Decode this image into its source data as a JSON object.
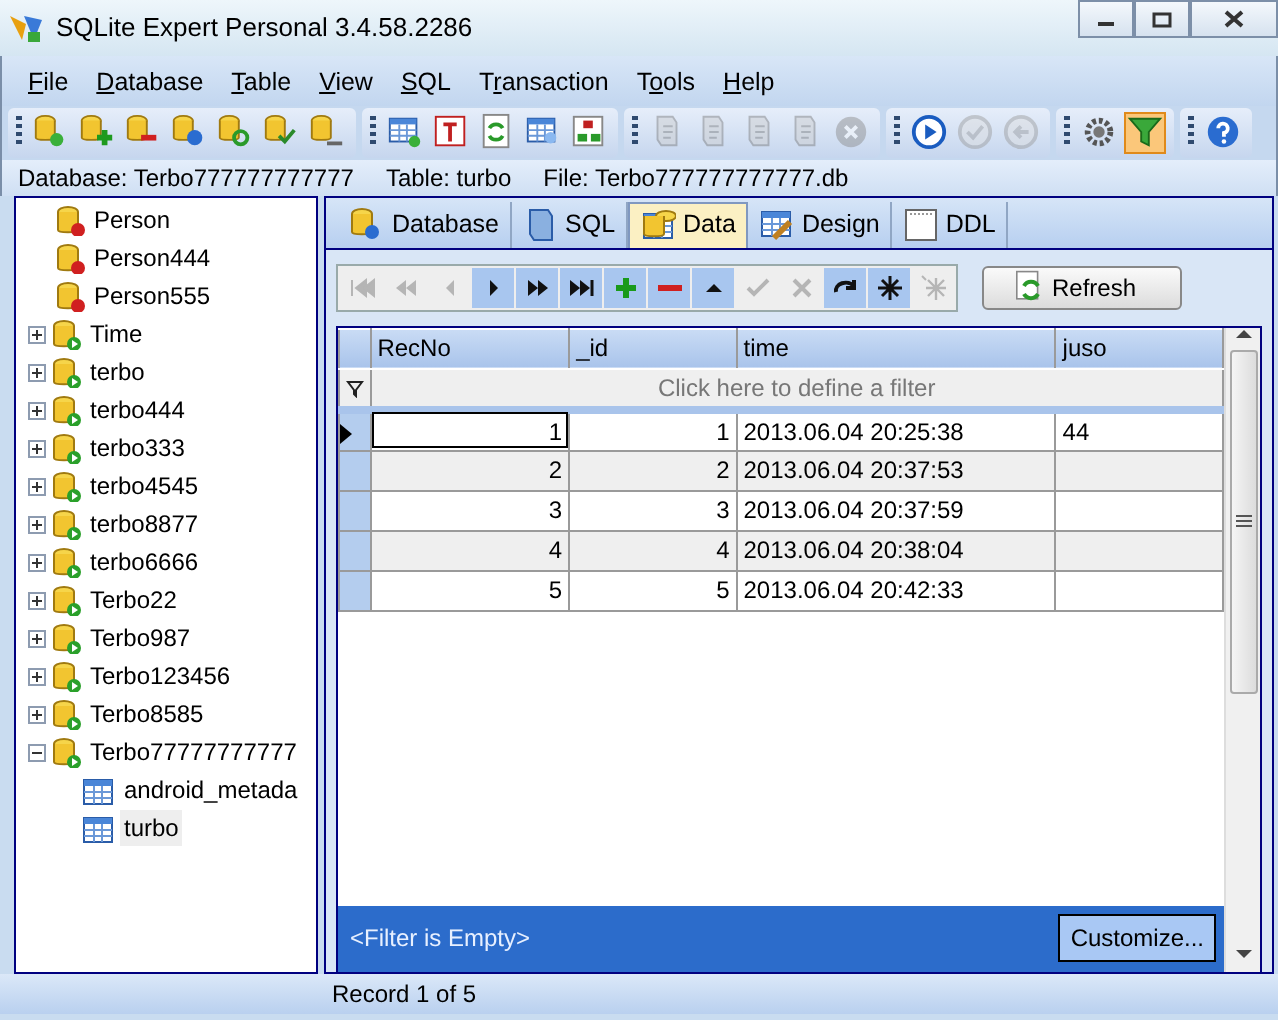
{
  "window": {
    "title": "SQLite Expert Personal 3.4.58.2286"
  },
  "menu": [
    {
      "key": "F",
      "after": "ile"
    },
    {
      "key": "D",
      "after": "atabase"
    },
    {
      "key": "T",
      "after": "able"
    },
    {
      "key": "V",
      "after": "iew"
    },
    {
      "key": "S",
      "after": "QL"
    },
    {
      "before": "T",
      "key": "r",
      "after": "ansaction"
    },
    {
      "before": "T",
      "key": "o",
      "after": "ols"
    },
    {
      "key": "H",
      "after": "elp"
    }
  ],
  "toolbar": [
    [
      {
        "kind": "db-new",
        "disabled": false,
        "on": false
      },
      {
        "kind": "db-add",
        "disabled": false,
        "on": false
      },
      {
        "kind": "db-remove",
        "disabled": false,
        "on": false
      },
      {
        "kind": "db-settings",
        "disabled": false,
        "on": false
      },
      {
        "kind": "db-attach",
        "disabled": false,
        "on": false
      },
      {
        "kind": "db-check",
        "disabled": false,
        "on": false
      },
      {
        "kind": "db-export",
        "disabled": false,
        "on": false
      }
    ],
    [
      {
        "kind": "table-new",
        "disabled": false,
        "on": false
      },
      {
        "kind": "table-text",
        "disabled": false,
        "on": false
      },
      {
        "kind": "refresh",
        "disabled": false,
        "on": false
      },
      {
        "kind": "table-edit",
        "disabled": false,
        "on": false
      },
      {
        "kind": "tree",
        "disabled": false,
        "on": false
      }
    ],
    [
      {
        "kind": "script",
        "disabled": true,
        "on": false
      },
      {
        "kind": "script",
        "disabled": true,
        "on": false
      },
      {
        "kind": "script",
        "disabled": true,
        "on": false
      },
      {
        "kind": "script",
        "disabled": true,
        "on": false
      },
      {
        "kind": "stop",
        "disabled": true,
        "on": false
      }
    ],
    [
      {
        "kind": "play",
        "disabled": false,
        "on": false
      },
      {
        "kind": "check",
        "disabled": true,
        "on": false
      },
      {
        "kind": "back",
        "disabled": true,
        "on": false
      }
    ],
    [
      {
        "kind": "gear",
        "disabled": false,
        "on": false
      },
      {
        "kind": "funnel",
        "disabled": false,
        "on": true
      }
    ],
    [
      {
        "kind": "help",
        "disabled": false,
        "on": false
      }
    ]
  ],
  "info_bar": {
    "database": "Database: Terbo777777777777",
    "table": "Table: turbo",
    "file": "File: Terbo777777777777.db"
  },
  "tree": [
    {
      "label": "Person",
      "kind": "view"
    },
    {
      "label": "Person444",
      "kind": "view"
    },
    {
      "label": "Person555",
      "kind": "view"
    },
    {
      "label": "Time",
      "kind": "database",
      "expanded": false
    },
    {
      "label": "terbo",
      "kind": "database",
      "expanded": false
    },
    {
      "label": "terbo444",
      "kind": "database",
      "expanded": false
    },
    {
      "label": "terbo333",
      "kind": "database",
      "expanded": false
    },
    {
      "label": "terbo4545",
      "kind": "database",
      "expanded": false
    },
    {
      "label": "terbo8877",
      "kind": "database",
      "expanded": false
    },
    {
      "label": "terbo6666",
      "kind": "database",
      "expanded": false
    },
    {
      "label": "Terbo22",
      "kind": "database",
      "expanded": false
    },
    {
      "label": "Terbo987",
      "kind": "database",
      "expanded": false
    },
    {
      "label": "Terbo123456",
      "kind": "database",
      "expanded": false
    },
    {
      "label": "Terbo8585",
      "kind": "database",
      "expanded": false
    },
    {
      "label": "Terbo77777777777",
      "kind": "database",
      "expanded": true,
      "children": [
        {
          "label": "android_metada",
          "kind": "table",
          "selected": false
        },
        {
          "label": "turbo",
          "kind": "table",
          "selected": true
        }
      ]
    }
  ],
  "tabs": [
    {
      "label": "Database",
      "kind": "database",
      "selected": false
    },
    {
      "label": "SQL",
      "kind": "sql",
      "selected": false
    },
    {
      "label": "Data",
      "kind": "data",
      "selected": true
    },
    {
      "label": "Design",
      "kind": "design",
      "selected": false
    },
    {
      "label": "DDL",
      "kind": "ddl",
      "selected": false
    }
  ],
  "navigator": [
    {
      "kind": "first",
      "disabled": true
    },
    {
      "kind": "prior-page",
      "disabled": true
    },
    {
      "kind": "prior",
      "disabled": true
    },
    {
      "kind": "next",
      "disabled": false
    },
    {
      "kind": "next-page",
      "disabled": false
    },
    {
      "kind": "last",
      "disabled": false
    },
    {
      "kind": "insert",
      "disabled": false
    },
    {
      "kind": "delete",
      "disabled": false
    },
    {
      "kind": "edit",
      "disabled": false
    },
    {
      "kind": "post",
      "disabled": true
    },
    {
      "kind": "cancel",
      "disabled": true
    },
    {
      "kind": "refresh",
      "disabled": false
    },
    {
      "kind": "bookmark",
      "disabled": false
    },
    {
      "kind": "goto-bookmark",
      "disabled": true
    }
  ],
  "refresh_button": "Refresh",
  "table": {
    "columns": [
      "RecNo",
      "_id",
      "time",
      "juso"
    ],
    "filter_hint": "Click here to define a filter",
    "rows": [
      {
        "cells": [
          "1",
          "1",
          "2013.06.04 20:25:38",
          "44"
        ],
        "selected": true
      },
      {
        "cells": [
          "2",
          "2",
          "2013.06.04 20:37:53",
          ""
        ],
        "selected": false
      },
      {
        "cells": [
          "3",
          "3",
          "2013.06.04 20:37:59",
          ""
        ],
        "selected": false
      },
      {
        "cells": [
          "4",
          "4",
          "2013.06.04 20:38:04",
          ""
        ],
        "selected": false
      },
      {
        "cells": [
          "5",
          "5",
          "2013.06.04 20:42:33",
          ""
        ],
        "selected": false
      }
    ]
  },
  "filter_panel": {
    "status": "<Filter is Empty>",
    "button": "Customize..."
  },
  "status_bar": "Record 1 of 5"
}
